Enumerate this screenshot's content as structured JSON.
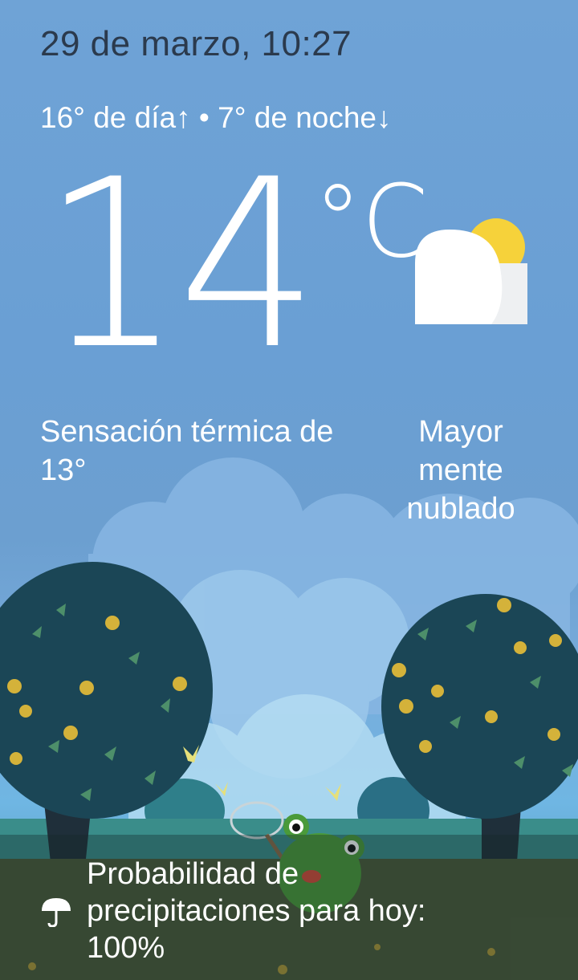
{
  "header": {
    "date_time": "29 de marzo, 10:27",
    "hi_lo": "16° de día↑ • 7° de noche↓"
  },
  "current": {
    "temperature": "14",
    "unit": "°C",
    "feels_like": "Sensación térmica de 13°",
    "condition": "Mayor mente nublado",
    "condition_icon": "cloud-sun-icon"
  },
  "precipitation": {
    "icon": "umbrella-icon",
    "text": "Probabilidad de precipitaciones para hoy: 100%"
  },
  "colors": {
    "sky_top": "#6fa3d6",
    "date_text": "#2b3a4d",
    "sun": "#f6d23a",
    "tree_dark": "#1d4a5a",
    "frog_green": "#4a9a3a"
  }
}
